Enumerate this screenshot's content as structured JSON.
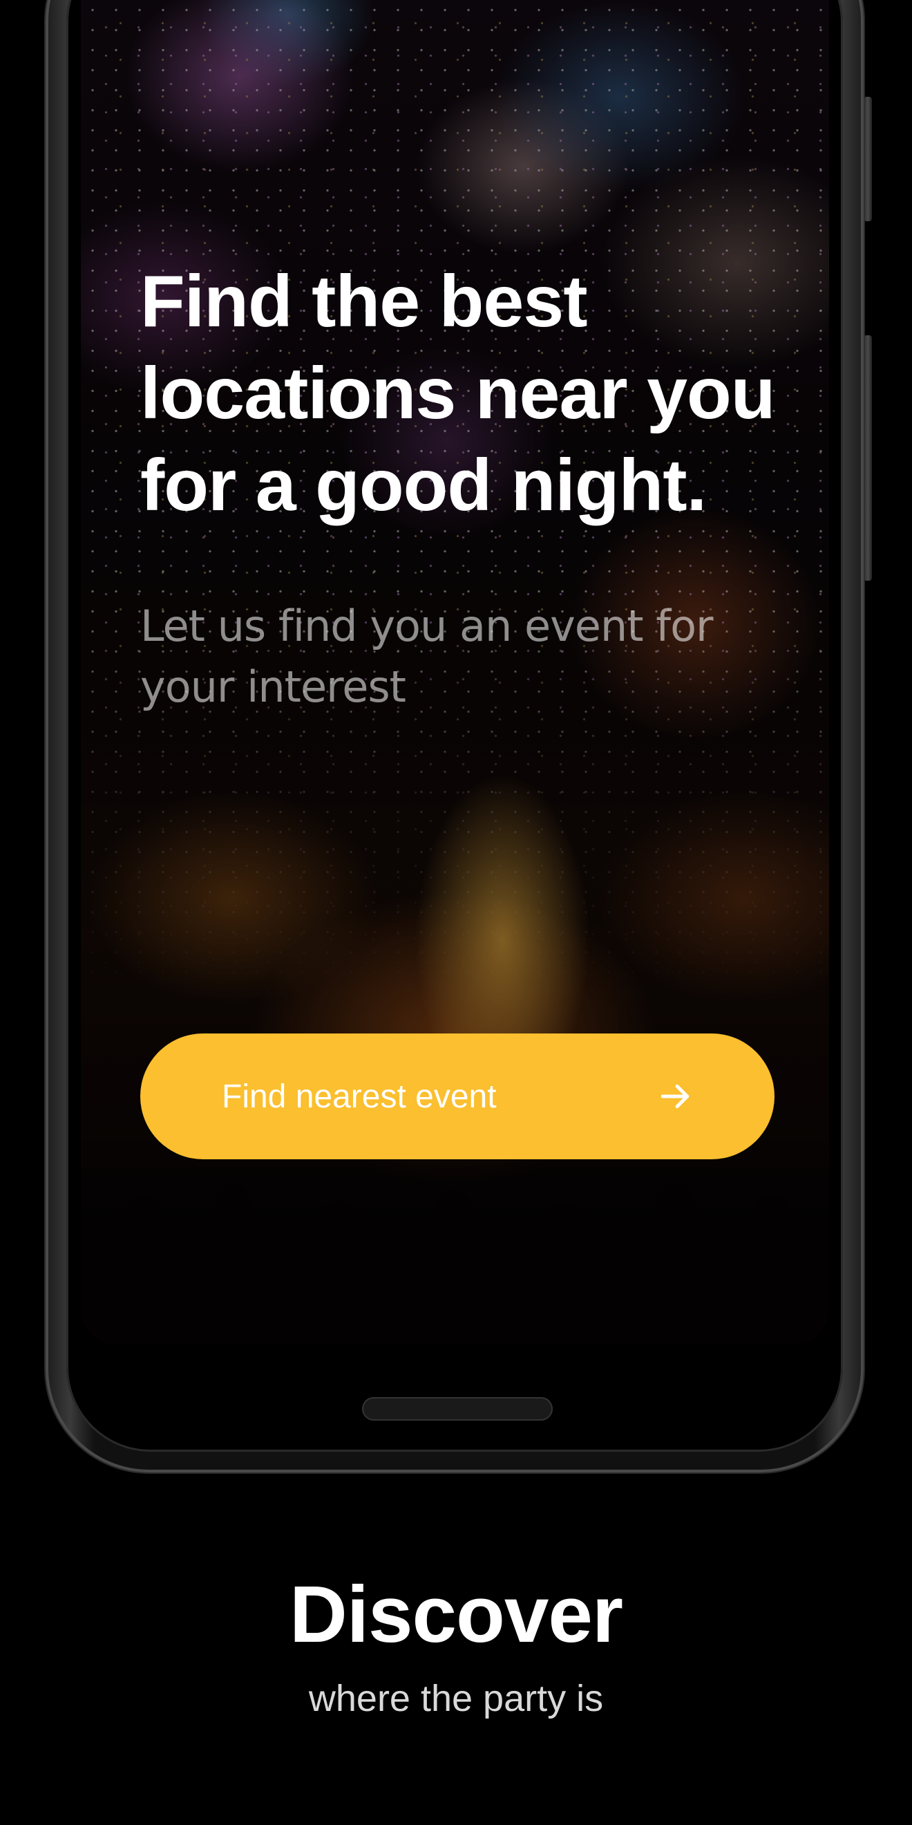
{
  "screen": {
    "headline_line1": "Find the best",
    "headline_line2": "locations near you",
    "headline_line3": "for a good night.",
    "subheadline_line1": "Let us find you an event for",
    "subheadline_line2": "your interest",
    "cta": {
      "label": "Find nearest event",
      "icon": "arrow-right-icon",
      "color": "#fbbf2f"
    },
    "background": "fireworks-night-photo"
  },
  "caption": {
    "title": "Discover",
    "subtitle": "where the party is"
  }
}
